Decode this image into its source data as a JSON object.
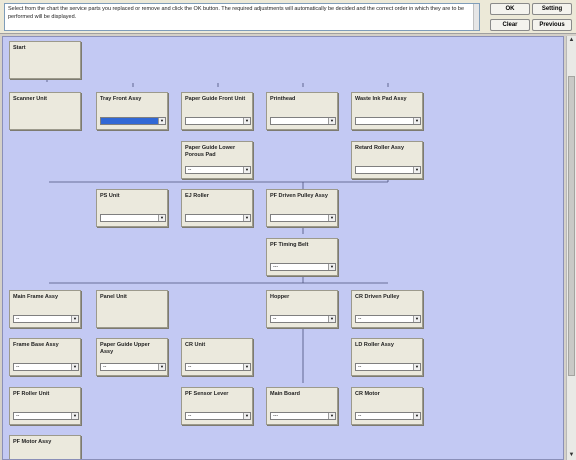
{
  "instructions": "Select from the chart the service parts you replaced or remove and click the OK button. The required adjustments will automatically be decided and the correct order in which they are to be performed will be displayed.",
  "buttons": {
    "ok": "OK",
    "setting": "Setting",
    "clear": "Clear",
    "previous": "Previous"
  },
  "nodes": {
    "start": {
      "label": "Start"
    },
    "scanner_unit": {
      "label": "Scanner Unit"
    },
    "tray_front_assy": {
      "label": "Tray Front Assy",
      "value": ""
    },
    "paper_guide_front_unit": {
      "label": "Paper Guide Front Unit",
      "value": ""
    },
    "printhead": {
      "label": "Printhead",
      "value": ""
    },
    "waste_ink_pad_assy": {
      "label": "Waste Ink Pad Assy",
      "value": ""
    },
    "paper_guide_lower_porous_pad": {
      "label": "Paper Guide Lower Porous Pad",
      "value": "--"
    },
    "retard_roller_assy": {
      "label": "Retard Roller Assy",
      "value": ""
    },
    "ps_unit": {
      "label": "PS Unit",
      "value": ""
    },
    "ej_roller": {
      "label": "EJ Roller",
      "value": ""
    },
    "pf_driven_pulley_assy": {
      "label": "PF Driven Pulley Assy",
      "value": ""
    },
    "pf_timing_belt": {
      "label": "PF Timing Belt",
      "value": "---"
    },
    "main_frame_assy": {
      "label": "Main Frame Assy",
      "value": "--"
    },
    "panel_unit": {
      "label": "Panel Unit"
    },
    "hopper": {
      "label": "Hopper",
      "value": "--"
    },
    "cr_driven_pulley": {
      "label": "CR Driven Pulley",
      "value": "--"
    },
    "frame_base_assy": {
      "label": "Frame Base Assy",
      "value": "--"
    },
    "paper_guide_upper_assy": {
      "label": "Paper Guide Upper Assy",
      "value": "--"
    },
    "cr_unit": {
      "label": "CR Unit",
      "value": "--"
    },
    "ld_roller_assy": {
      "label": "LD Roller Assy",
      "value": "--"
    },
    "pf_roller_unit": {
      "label": "PF Roller Unit",
      "value": "--"
    },
    "pf_sensor_lever": {
      "label": "PF Sensor Lever",
      "value": "--"
    },
    "main_board": {
      "label": "Main Board",
      "value": "---"
    },
    "cr_motor": {
      "label": "CR Motor",
      "value": "--"
    },
    "pf_motor_assy": {
      "label": "PF Motor Assy"
    }
  }
}
